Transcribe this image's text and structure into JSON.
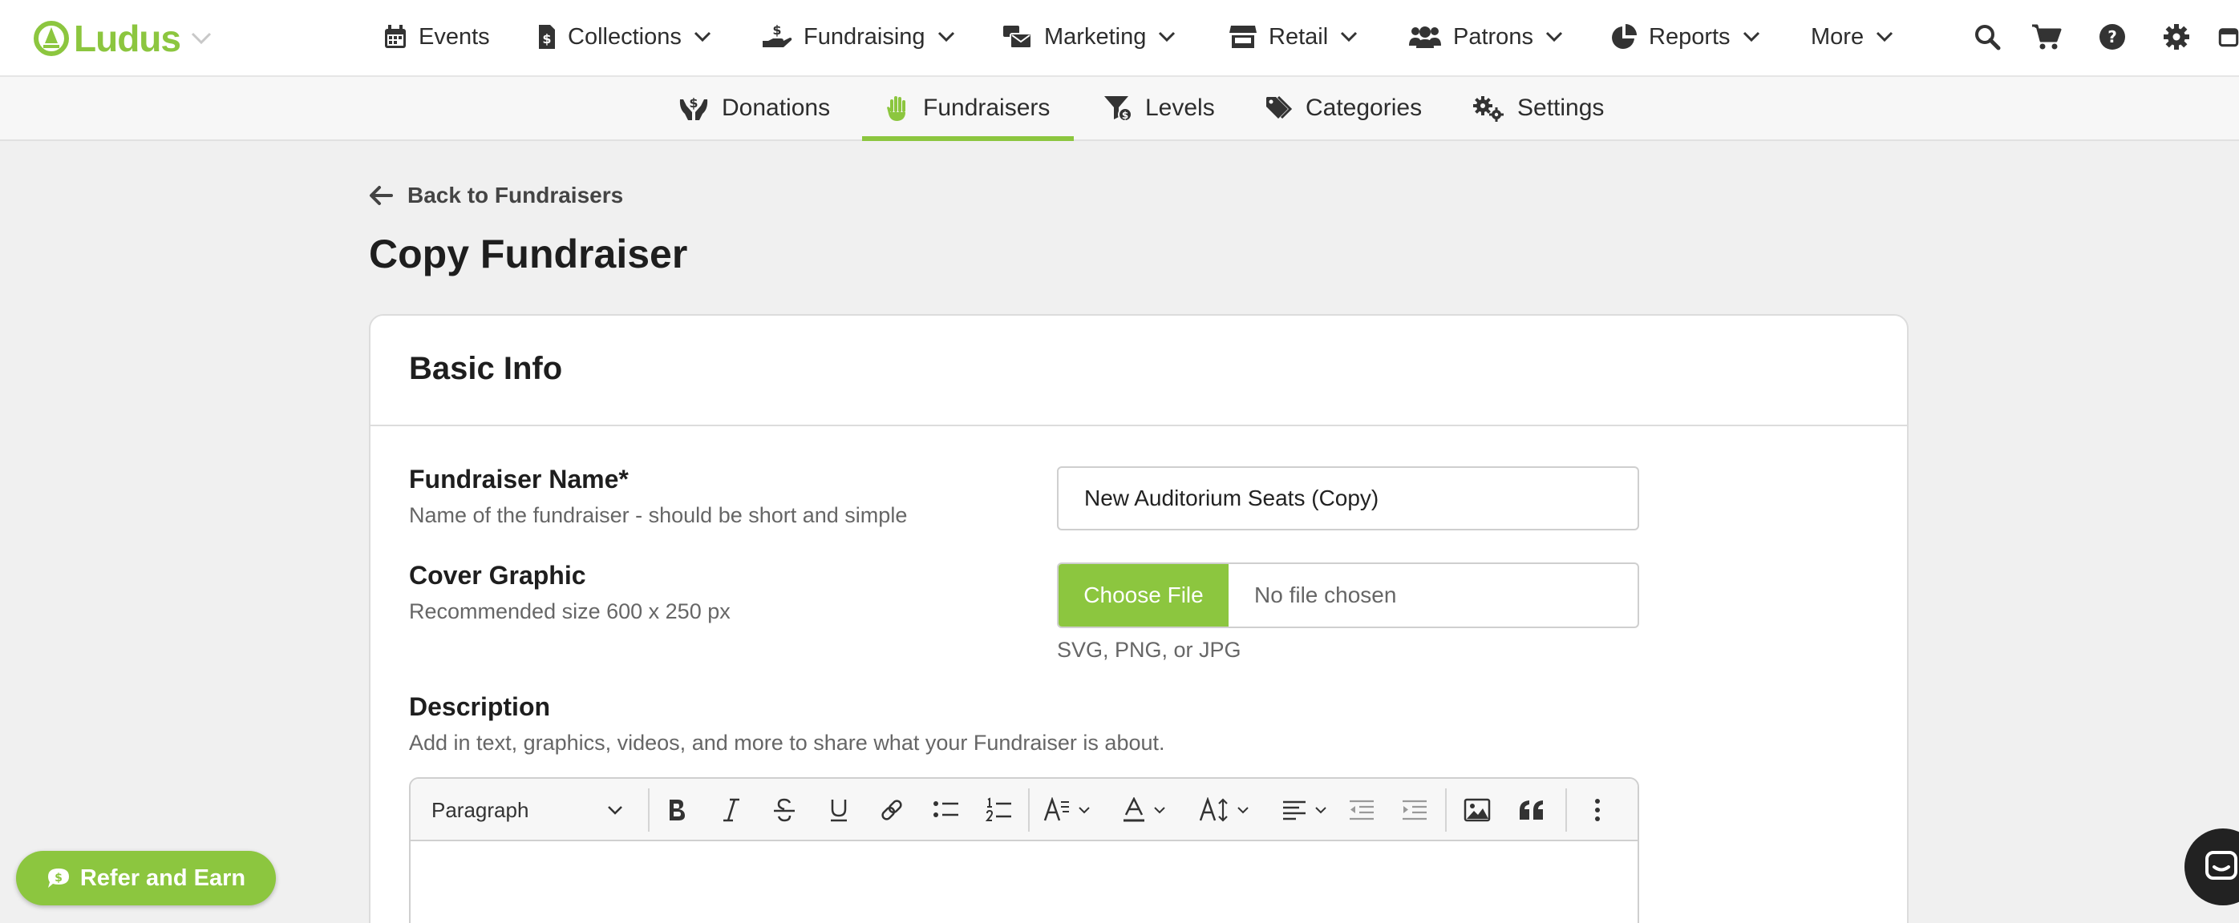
{
  "app": {
    "name": "Ludus",
    "brand_color": "#8cc63f"
  },
  "nav": {
    "items": [
      {
        "label": "Events",
        "icon": "calendar-icon",
        "dropdown": false
      },
      {
        "label": "Collections",
        "icon": "invoice-dollar-icon",
        "dropdown": true
      },
      {
        "label": "Fundraising",
        "icon": "hand-holding-dollar-icon",
        "dropdown": true
      },
      {
        "label": "Marketing",
        "icon": "mail-bulk-icon",
        "dropdown": true
      },
      {
        "label": "Retail",
        "icon": "store-icon",
        "dropdown": true
      },
      {
        "label": "Patrons",
        "icon": "users-icon",
        "dropdown": true
      },
      {
        "label": "Reports",
        "icon": "pie-chart-icon",
        "dropdown": true
      },
      {
        "label": "More",
        "icon": "",
        "dropdown": true
      }
    ],
    "utility_icons": [
      "search-icon",
      "cart-icon",
      "help-icon",
      "gear-icon",
      "calendar-check-icon"
    ]
  },
  "subnav": {
    "tabs": [
      {
        "label": "Donations",
        "icon": "hands-dollar-icon",
        "active": false
      },
      {
        "label": "Fundraisers",
        "icon": "hand-raised-icon",
        "active": true
      },
      {
        "label": "Levels",
        "icon": "filter-dollar-icon",
        "active": false
      },
      {
        "label": "Categories",
        "icon": "tags-icon",
        "active": false
      },
      {
        "label": "Settings",
        "icon": "gears-icon",
        "active": false
      }
    ]
  },
  "page": {
    "back_label": "Back to Fundraisers",
    "title": "Copy Fundraiser"
  },
  "basic_info": {
    "heading": "Basic Info",
    "name_label": "Fundraiser Name*",
    "name_help": "Name of the fundraiser - should be short and simple",
    "name_value": "New Auditorium Seats (Copy)",
    "cover_label": "Cover Graphic",
    "cover_help": "Recommended size 600 x 250 px",
    "choose_file_label": "Choose File",
    "file_status": "No file chosen",
    "file_hint": "SVG, PNG, or JPG",
    "description_label": "Description",
    "description_help": "Add in text, graphics, videos, and more to share what your Fundraiser is about."
  },
  "editor": {
    "block_format": "Paragraph",
    "tools": [
      "bold-icon",
      "italic-icon",
      "strikethrough-icon",
      "underline-icon",
      "link-icon",
      "bulleted-list-icon",
      "numbered-list-icon",
      "font-family-icon",
      "font-color-icon",
      "font-size-icon",
      "align-icon",
      "outdent-icon",
      "indent-icon",
      "image-icon",
      "blockquote-icon",
      "more-vertical-icon"
    ]
  },
  "floating": {
    "refer_label": "Refer and Earn"
  }
}
